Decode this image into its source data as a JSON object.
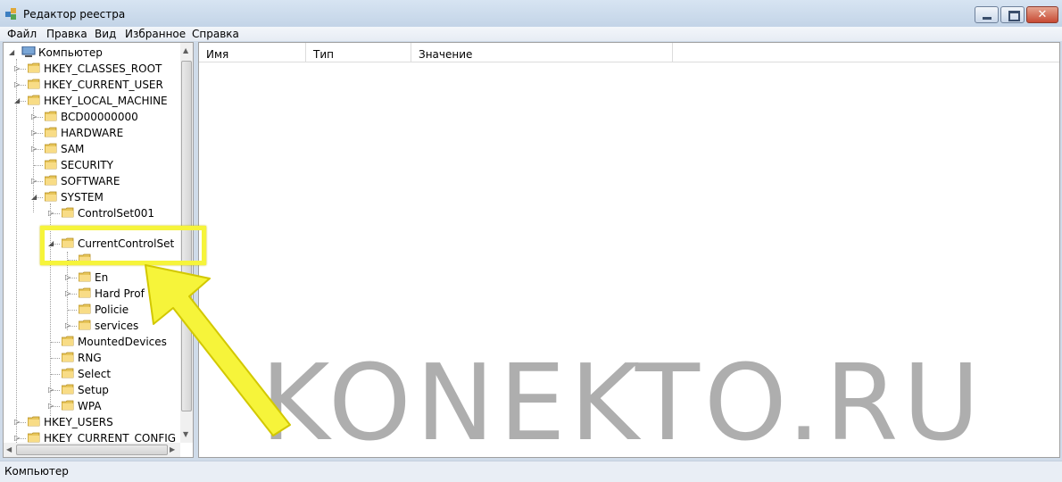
{
  "window": {
    "title": "Редактор реестра",
    "close_glyph": "✕"
  },
  "menu": [
    "Файл",
    "Правка",
    "Вид",
    "Избранное",
    "Справка"
  ],
  "tree": {
    "root": "Компьютер",
    "items": [
      "HKEY_CLASSES_ROOT",
      "HKEY_CURRENT_USER",
      "HKEY_LOCAL_MACHINE",
      "BCD00000000",
      "HARDWARE",
      "SAM",
      "SECURITY",
      "SOFTWARE",
      "SYSTEM",
      "ControlSet001",
      "CurrentControlSet",
      "",
      "En",
      "Hard    Prof",
      "Policie",
      "services",
      "MountedDevices",
      "RNG",
      "Select",
      "Setup",
      "WPA",
      "HKEY_USERS",
      "HKEY_CURRENT_CONFIG"
    ]
  },
  "list": {
    "columns": [
      "Имя",
      "Тип",
      "Значение"
    ]
  },
  "status": {
    "text": "Компьютер"
  },
  "watermark": "KONEKTO.RU",
  "colors": {
    "highlight": "#f6f43a",
    "arrow": "#f6f43a"
  },
  "icons": {
    "folder": "folder-icon",
    "computer": "computer-icon",
    "expand": "triangle-right-icon",
    "collapse": "triangle-down-icon"
  }
}
